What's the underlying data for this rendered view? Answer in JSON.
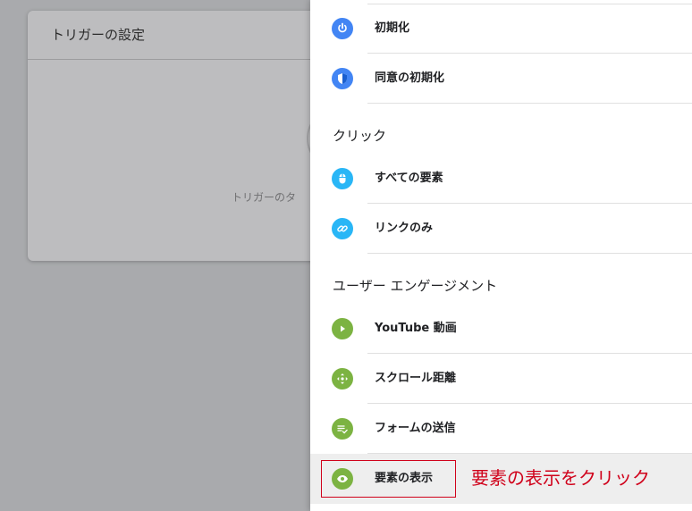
{
  "background_card": {
    "title": "トリガーの設定",
    "hint": "トリガーのタ"
  },
  "panel": {
    "top_items": [
      {
        "label": "初期化",
        "icon": "power-icon",
        "color": "#4285f4"
      },
      {
        "label": "同意の初期化",
        "icon": "shield-icon",
        "color": "#4285f4"
      }
    ],
    "sections": [
      {
        "header": "クリック",
        "items": [
          {
            "label": "すべての要素",
            "icon": "mouse-icon",
            "color": "#29b6f6"
          },
          {
            "label": "リンクのみ",
            "icon": "link-icon",
            "color": "#29b6f6"
          }
        ]
      },
      {
        "header": "ユーザー エンゲージメント",
        "items": [
          {
            "label": "YouTube 動画",
            "icon": "play-icon",
            "color": "#7cb342"
          },
          {
            "label": "スクロール距離",
            "icon": "move-arrows-icon",
            "color": "#7cb342"
          },
          {
            "label": "フォームの送信",
            "icon": "form-submit-icon",
            "color": "#7cb342"
          },
          {
            "label": "要素の表示",
            "icon": "eye-icon",
            "color": "#7cb342"
          }
        ]
      }
    ]
  },
  "annotation": {
    "text": "要素の表示をクリック",
    "color": "#d0021b"
  }
}
